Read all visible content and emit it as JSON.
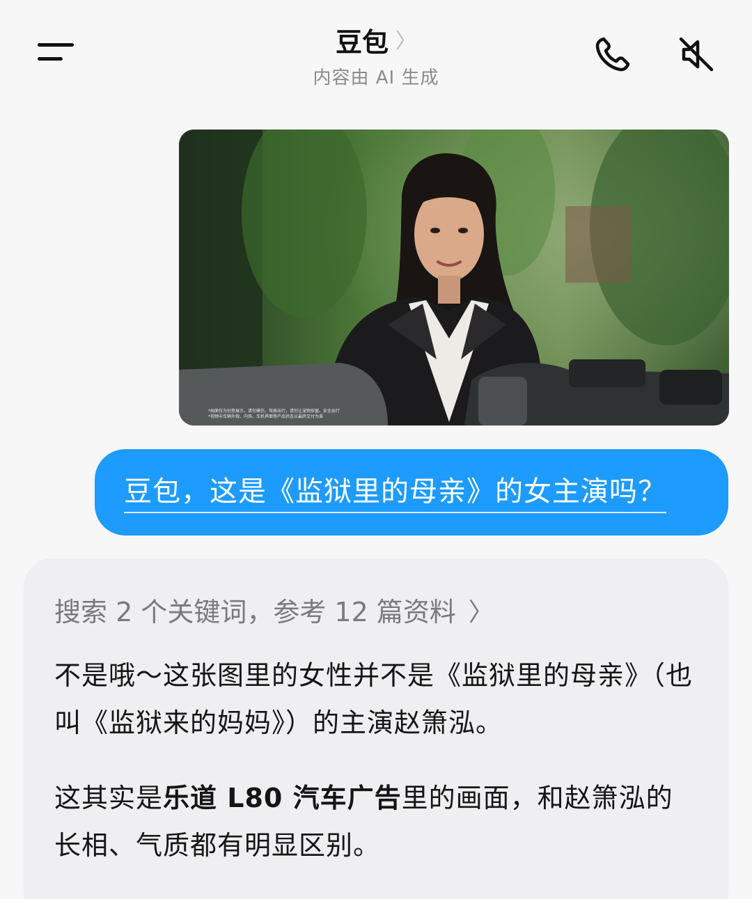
{
  "header": {
    "title": "豆包",
    "subtitle": "内容由 AI 生成"
  },
  "image_message": {
    "caption_line1": "*画面仅为创意展示，请勿模仿。驾乘出行，请勿让宠物探窗。安全出行",
    "caption_line2": "*视频中车辆外观、内饰、车机界面等产品状态以最终交付为准"
  },
  "user_message": {
    "text": "豆包，这是《监狱里的母亲》的女主演吗？"
  },
  "ai_reply": {
    "search_summary": "搜索 2 个关键词，参考 12 篇资料",
    "para1": "不是哦～这张图里的女性并不是《监狱里的母亲》（也叫《监狱来的妈妈》）的主演赵箫泓。",
    "para2_pre": "这其实是",
    "para2_bold": "乐道 L80 汽车广告",
    "para2_post": "里的画面，和赵箫泓的长相、气质都有明显区别。"
  },
  "colors": {
    "user_bubble": "#1e9bff",
    "ai_card": "#efeff1",
    "background": "#f7f7f8"
  },
  "icons": [
    "menu-icon",
    "chevron-right-icon",
    "phone-icon",
    "mute-speaker-icon"
  ]
}
